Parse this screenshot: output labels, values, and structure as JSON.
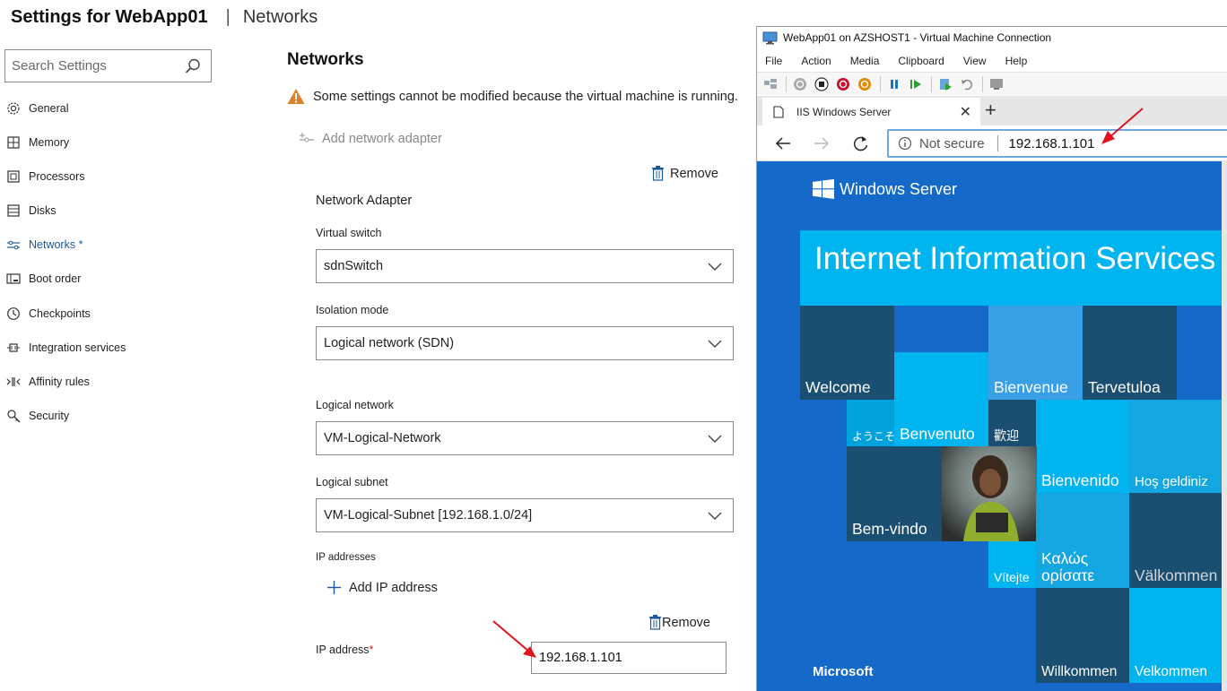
{
  "header": {
    "title": "Settings for WebApp01",
    "separator": "|",
    "subtitle": "Networks"
  },
  "search": {
    "placeholder": "Search Settings"
  },
  "sidebar": {
    "items": [
      {
        "label": "General",
        "icon": "gear-icon"
      },
      {
        "label": "Memory",
        "icon": "memory-icon"
      },
      {
        "label": "Processors",
        "icon": "processor-icon"
      },
      {
        "label": "Disks",
        "icon": "disk-icon"
      },
      {
        "label": "Networks *",
        "icon": "network-icon",
        "active": true
      },
      {
        "label": "Boot order",
        "icon": "boot-order-icon"
      },
      {
        "label": "Checkpoints",
        "icon": "clock-icon"
      },
      {
        "label": "Integration services",
        "icon": "integration-icon"
      },
      {
        "label": "Affinity rules",
        "icon": "affinity-icon"
      },
      {
        "label": "Security",
        "icon": "security-key-icon"
      }
    ]
  },
  "main": {
    "title": "Networks",
    "warning": "Some settings cannot be modified because the virtual machine is running.",
    "add_adapter": "Add network adapter",
    "remove_adapter": "Remove",
    "adapter_heading": "Network Adapter",
    "virtual_switch": {
      "label": "Virtual switch",
      "value": "sdnSwitch"
    },
    "isolation_mode": {
      "label": "Isolation mode",
      "value": "Logical network (SDN)"
    },
    "logical_network": {
      "label": "Logical network",
      "value": "VM-Logical-Network"
    },
    "logical_subnet": {
      "label": "Logical subnet",
      "value": "VM-Logical-Subnet [192.168.1.0/24]"
    },
    "ip_addresses_label": "IP addresses",
    "add_ip": "Add IP address",
    "remove_ip": "Remove",
    "ip_address": {
      "label": "IP address",
      "required_mark": "*",
      "value": "192.168.1.101"
    }
  },
  "vm_window": {
    "title": "WebApp01 on AZSHOST1 - Virtual Machine Connection",
    "menu": [
      "File",
      "Action",
      "Media",
      "Clipboard",
      "View",
      "Help"
    ],
    "browser": {
      "tab_title": "IIS Windows Server",
      "not_secure": "Not secure",
      "url": "192.168.1.101"
    },
    "iis": {
      "brand": "Windows Server",
      "banner": "Internet Information Services",
      "footer": "Microsoft",
      "tiles": {
        "welcome": "Welcome",
        "bienvenue": "Bienvenue",
        "tervetuloa": "Tervetuloa",
        "youkoso": "ようこそ",
        "benvenuto": "Benvenuto",
        "huanying": "歡迎",
        "bienvenido": "Bienvenido",
        "hos_geldiniz": "Hoş geldiniz",
        "bem_vindo": "Bem-vindo",
        "kalos": "Καλώς ορίσατε",
        "vitejte": "Vítejte",
        "valkommen": "Välkommen",
        "willkommen": "Willkommen",
        "velkommen": "Velkommen"
      }
    }
  },
  "colors": {
    "accent": "#1a5a9a",
    "warning": "#d9822b",
    "iis_blue": "#1469c9",
    "iis_cyan": "#00b4f0",
    "iis_dark": "#1b4f72",
    "arrow": "#e0141e"
  }
}
